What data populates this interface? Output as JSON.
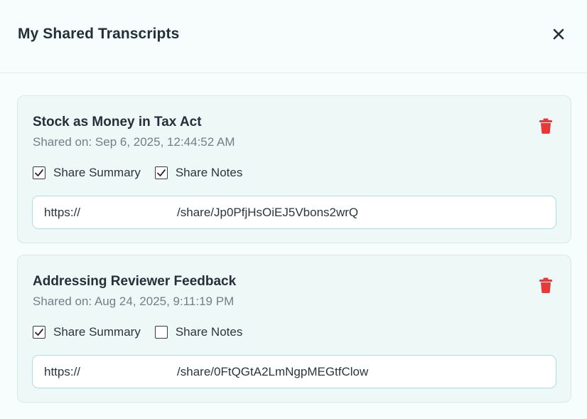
{
  "dialog": {
    "title": "My Shared Transcripts",
    "close_icon": "close-icon"
  },
  "colors": {
    "delete": "#e5393a",
    "field_border": "#a8e2e0",
    "card_bg": "#eef8f7"
  },
  "transcripts": [
    {
      "title": "Stock as Money in Tax Act",
      "shared_on": "Shared on: Sep 6, 2025, 12:44:52 AM",
      "share_summary": {
        "label": "Share Summary",
        "checked": true
      },
      "share_notes": {
        "label": "Share Notes",
        "checked": true
      },
      "link_prefix": "https://",
      "link_path": "/share/Jp0PfjHsOiEJ5Vbons2wrQ",
      "delete_icon": "trash-icon"
    },
    {
      "title": "Addressing Reviewer Feedback",
      "shared_on": "Shared on: Aug 24, 2025, 9:11:19 PM",
      "share_summary": {
        "label": "Share Summary",
        "checked": true
      },
      "share_notes": {
        "label": "Share Notes",
        "checked": false
      },
      "link_prefix": "https://",
      "link_path": "/share/0FtQGtA2LmNgpMEGtfClow",
      "delete_icon": "trash-icon"
    }
  ]
}
